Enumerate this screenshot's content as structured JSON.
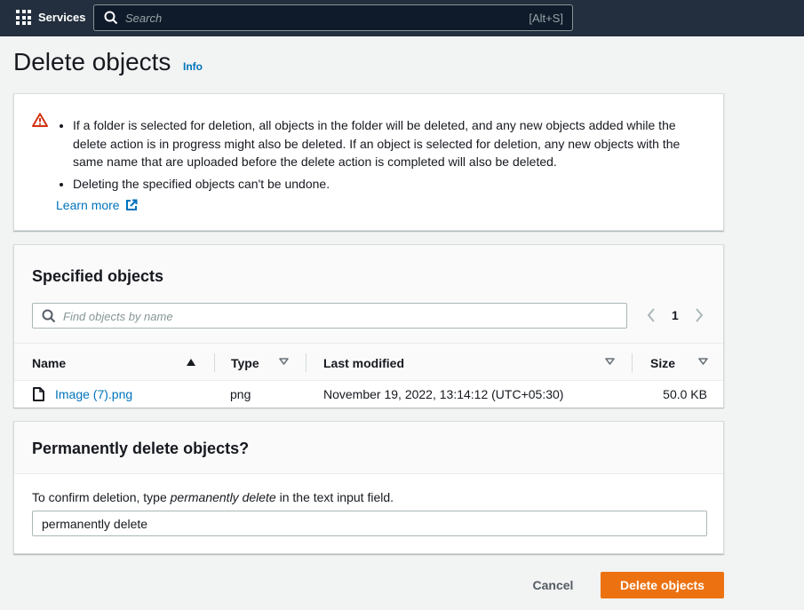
{
  "topnav": {
    "services_label": "Services",
    "search_placeholder": "Search",
    "search_shortcut": "[Alt+S]"
  },
  "header": {
    "title": "Delete objects",
    "info_label": "Info"
  },
  "alert": {
    "bullets": [
      "If a folder is selected for deletion, all objects in the folder will be deleted, and any new objects added while the delete action is in progress might also be deleted. If an object is selected for deletion, any new objects with the same name that are uploaded before the delete action is completed will also be deleted.",
      "Deleting the specified objects can't be undone."
    ],
    "learn_more": "Learn more"
  },
  "objects": {
    "heading": "Specified objects",
    "find_placeholder": "Find objects by name",
    "page": "1",
    "columns": {
      "name": "Name",
      "type": "Type",
      "last_modified": "Last modified",
      "size": "Size"
    },
    "rows": [
      {
        "name": "Image (7).png",
        "type": "png",
        "last_modified": "November 19, 2022, 13:14:12 (UTC+05:30)",
        "size": "50.0 KB"
      }
    ]
  },
  "confirm": {
    "heading": "Permanently delete objects?",
    "desc_prefix": "To confirm deletion, type ",
    "desc_keyword": "permanently delete",
    "desc_suffix": " in the text input field.",
    "input_value": "permanently delete"
  },
  "actions": {
    "cancel": "Cancel",
    "delete": "Delete objects"
  },
  "colors": {
    "nav_bg": "#232f3e",
    "link": "#0073bb",
    "primary_button": "#ec7211",
    "warning": "#d13212"
  }
}
